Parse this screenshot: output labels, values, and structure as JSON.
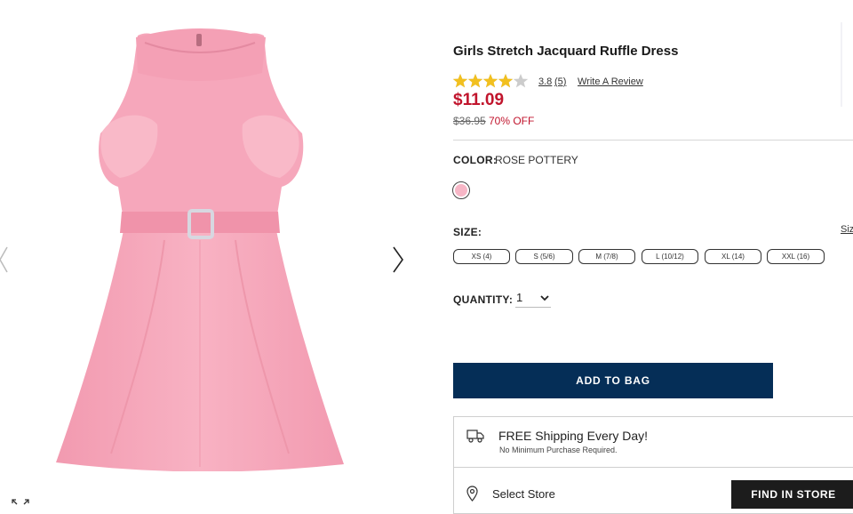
{
  "product": {
    "title": "Girls Stretch Jacquard Ruffle Dress",
    "rating": 3.8,
    "rating_display": "3.8",
    "review_count_display": "(5)",
    "write_review": "Write A Review",
    "price": "$11.09",
    "original_price": "$36.95",
    "discount": "70% OFF",
    "image_alt": "pink sleeveless dress with belt"
  },
  "color": {
    "label": "COLOR:",
    "value": "ROSE POTTERY",
    "swatch_hex": "#f7b6c6"
  },
  "size": {
    "label": "SIZE:",
    "guide_link": "Siz",
    "options": [
      "XS (4)",
      "S (5/6)",
      "M (7/8)",
      "L (10/12)",
      "XL (14)",
      "XXL (16)"
    ]
  },
  "quantity": {
    "label": "QUANTITY:",
    "value": "1"
  },
  "actions": {
    "add_to_bag": "ADD TO BAG",
    "find_in_store": "FIND IN STORE"
  },
  "shipping": {
    "title": "FREE Shipping Every Day!",
    "subtitle": "No Minimum Purchase Required."
  },
  "store": {
    "select_label": "Select Store"
  },
  "colors": {
    "price_red": "#c1152d",
    "button_navy": "#052e57",
    "star_gold": "#f5c518",
    "dress_pink": "#f7a9bc"
  },
  "icons": [
    "chevron-left-icon",
    "chevron-right-icon",
    "expand-icon",
    "star-icon",
    "truck-icon",
    "map-pin-icon",
    "chevron-down-icon"
  ]
}
